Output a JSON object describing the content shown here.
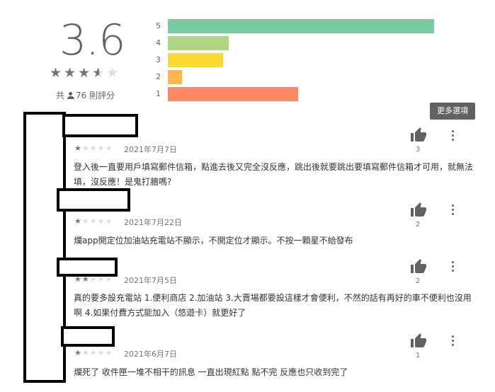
{
  "summary": {
    "score": "3.6",
    "total_prefix": "共",
    "total_count": "76 則評分",
    "star_value": 3.5
  },
  "distribution": [
    {
      "label": "5",
      "fraction": 0.96,
      "color": "#7acc9f"
    },
    {
      "label": "4",
      "fraction": 0.22,
      "color": "#aed582"
    },
    {
      "label": "3",
      "fraction": 0.2,
      "color": "#fdd835"
    },
    {
      "label": "2",
      "fraction": 0.05,
      "color": "#ffb74d"
    },
    {
      "label": "1",
      "fraction": 0.47,
      "color": "#ff8a65"
    }
  ],
  "more_options": "更多選項",
  "reviews": [
    {
      "rating": 1,
      "date": "2021年7月7日",
      "helpful": "3",
      "text": "登入後一直要用戶填寫郵件信箱，點進去後又完全沒反應，跳出後就要跳出要填寫郵件信箱才可用，就無法填，沒反應！是鬼打牆嗎?"
    },
    {
      "rating": 1,
      "date": "2021年7月22日",
      "helpful": "2",
      "text": "爛app開定位加油站充電站不顯示，不開定位才顯示。不按一顆星不給發布"
    },
    {
      "rating": 2,
      "date": "2021年7月5日",
      "helpful": "2",
      "text": "真的要多設充電站 1.便利商店 2.加油站 3.大賣場都要設這樣才會便利，不然的話有再好的車不便利也沒用啊 4.如果付費方式能加入（悠遊卡）就更好了"
    },
    {
      "rating": 1,
      "date": "2021年6月7日",
      "helpful": "1",
      "text": "爛死了 收件匣一堆不相干的訊息 一直出現紅點 點不完 反應也只收到完了"
    }
  ]
}
